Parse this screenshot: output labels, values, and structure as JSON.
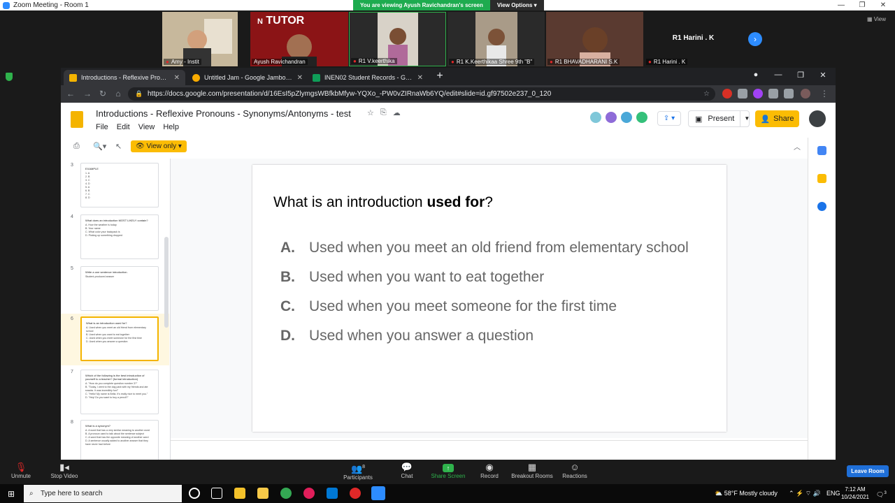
{
  "zoom": {
    "window_title": "Zoom Meeting - Room 1",
    "viewing_banner": "You are viewing Ayush Ravichandran's screen",
    "view_options": "View Options",
    "gallery_view_label": "View",
    "participants": [
      {
        "name": "Amy - Instit"
      },
      {
        "name": "Ayush Ravichandran"
      },
      {
        "name": "R1 V.keerthika"
      },
      {
        "name": "R1 K.Keerthikaa Shree 9th \"B\""
      },
      {
        "name": "R1 BHAVADHARANI S.K"
      },
      {
        "name": "R1 Harini . K"
      }
    ],
    "participant_card_name": "R1 Harini . K",
    "tutor_logo_text": "TUTOR",
    "controls": {
      "unmute": "Unmute",
      "stop_video": "Stop Video",
      "participants": "Participants",
      "participants_count": "8",
      "chat": "Chat",
      "share_screen": "Share Screen",
      "record": "Record",
      "breakout_rooms": "Breakout Rooms",
      "reactions": "Reactions",
      "leave_room": "Leave Room"
    }
  },
  "browser": {
    "tabs": [
      {
        "label": "Introductions - Reflexive Pronoun",
        "color": "#f4b400"
      },
      {
        "label": "Untitled Jam - Google Jamboard",
        "color": "#f9ab00"
      },
      {
        "label": "INEN02 Student Records - Googl",
        "color": "#0f9d58"
      }
    ],
    "url": "https://docs.google.com/presentation/d/16EsI5pZlymgsWBfkbMfyw-YQXo_-PW0vZIRnaWb6YQ/edit#slide=id.gf97502e237_0_120"
  },
  "slides": {
    "doc_title": "Introductions - Reflexive Pronouns - Synonyms/Antonyms - test",
    "menu": [
      "File",
      "Edit",
      "View",
      "Help"
    ],
    "present_label": "Present",
    "share_label": "Share",
    "view_only_label": "View only",
    "thumbnails": [
      {
        "num": "3",
        "title": "EXAMPLE",
        "lines": [
          "1. A",
          "2. B",
          "3. C",
          "4. D",
          "5. A",
          "6. B",
          "7. C",
          "8. D"
        ]
      },
      {
        "num": "4",
        "title": "What does an introduction MOST LIKELY contain?",
        "lines": [
          "A. How the weather is today",
          "B. Your name",
          "C. What color your backpack is",
          "D. Picking up something dropped"
        ]
      },
      {
        "num": "5",
        "title": "Write a one sentence introduction.",
        "lines": [
          "Student-produced answer"
        ]
      },
      {
        "num": "6",
        "title": "What is an introduction used for?",
        "lines": [
          "A. Used when you meet an old friend from elementary school",
          "B. Used when you want to eat together",
          "C. Used when you meet someone for the first time",
          "D. Used when you answer a question"
        ]
      },
      {
        "num": "7",
        "title": "Which of the following is the best introduction of yourself to a teacher? (formal introduction)",
        "lines": [
          "A. \"How do you complete question number 3?\"",
          "B. \"Today, I went to the dog park with my friends and ate snacks. It was incredibly fun!\"",
          "C. \"Hello! My name is Bella. It's really nice to meet you.\"",
          "D. \"Hey! Do you want to buy a pencil?\""
        ]
      },
      {
        "num": "8",
        "title": "What is a synonym?",
        "lines": [
          "A. A word that has a very similar meaning to another word",
          "B. A pronoun used to talk about the sentence subject",
          "C. A word that has the opposite meaning of another word",
          "D. A sentence usually added to another answer that they have never had before"
        ]
      }
    ],
    "current": {
      "question_prefix": "What is an introduction ",
      "question_bold": "used for",
      "question_suffix": "?",
      "options": [
        {
          "letter": "A.",
          "text": "Used when you meet an old friend from elementary school"
        },
        {
          "letter": "B.",
          "text": "Used when you want to eat together"
        },
        {
          "letter": "C.",
          "text": "Used when you meet someone for the first time"
        },
        {
          "letter": "D.",
          "text": "Used when you answer a question"
        }
      ]
    }
  },
  "taskbar": {
    "search_placeholder": "Type here to search",
    "weather": "58°F  Mostly cloudy",
    "language": "ENG",
    "time": "7:12 AM",
    "date": "10/24/2021",
    "notification_count": "3"
  }
}
